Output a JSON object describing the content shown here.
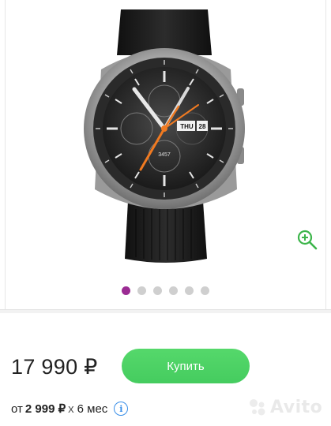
{
  "gallery": {
    "watch_date_day": "THU",
    "watch_date_num": "28",
    "watch_subdial": "3457",
    "slide_count": 6,
    "active_slide": 0,
    "zoom_icon": "zoom-in-icon"
  },
  "offer": {
    "price": "17 990 ₽",
    "buy_label": "Купить",
    "installment_prefix": "от",
    "installment_amount": "2 999 ₽",
    "installment_multiplier": "x",
    "installment_term": "6 мес",
    "info_icon": "info-icon"
  },
  "watermark": {
    "text": "Avito"
  },
  "colors": {
    "buy_button": "#4cd964",
    "active_dot": "#9b2b93",
    "zoom_icon": "#3cb54a",
    "info_icon": "#3a8fe8"
  }
}
